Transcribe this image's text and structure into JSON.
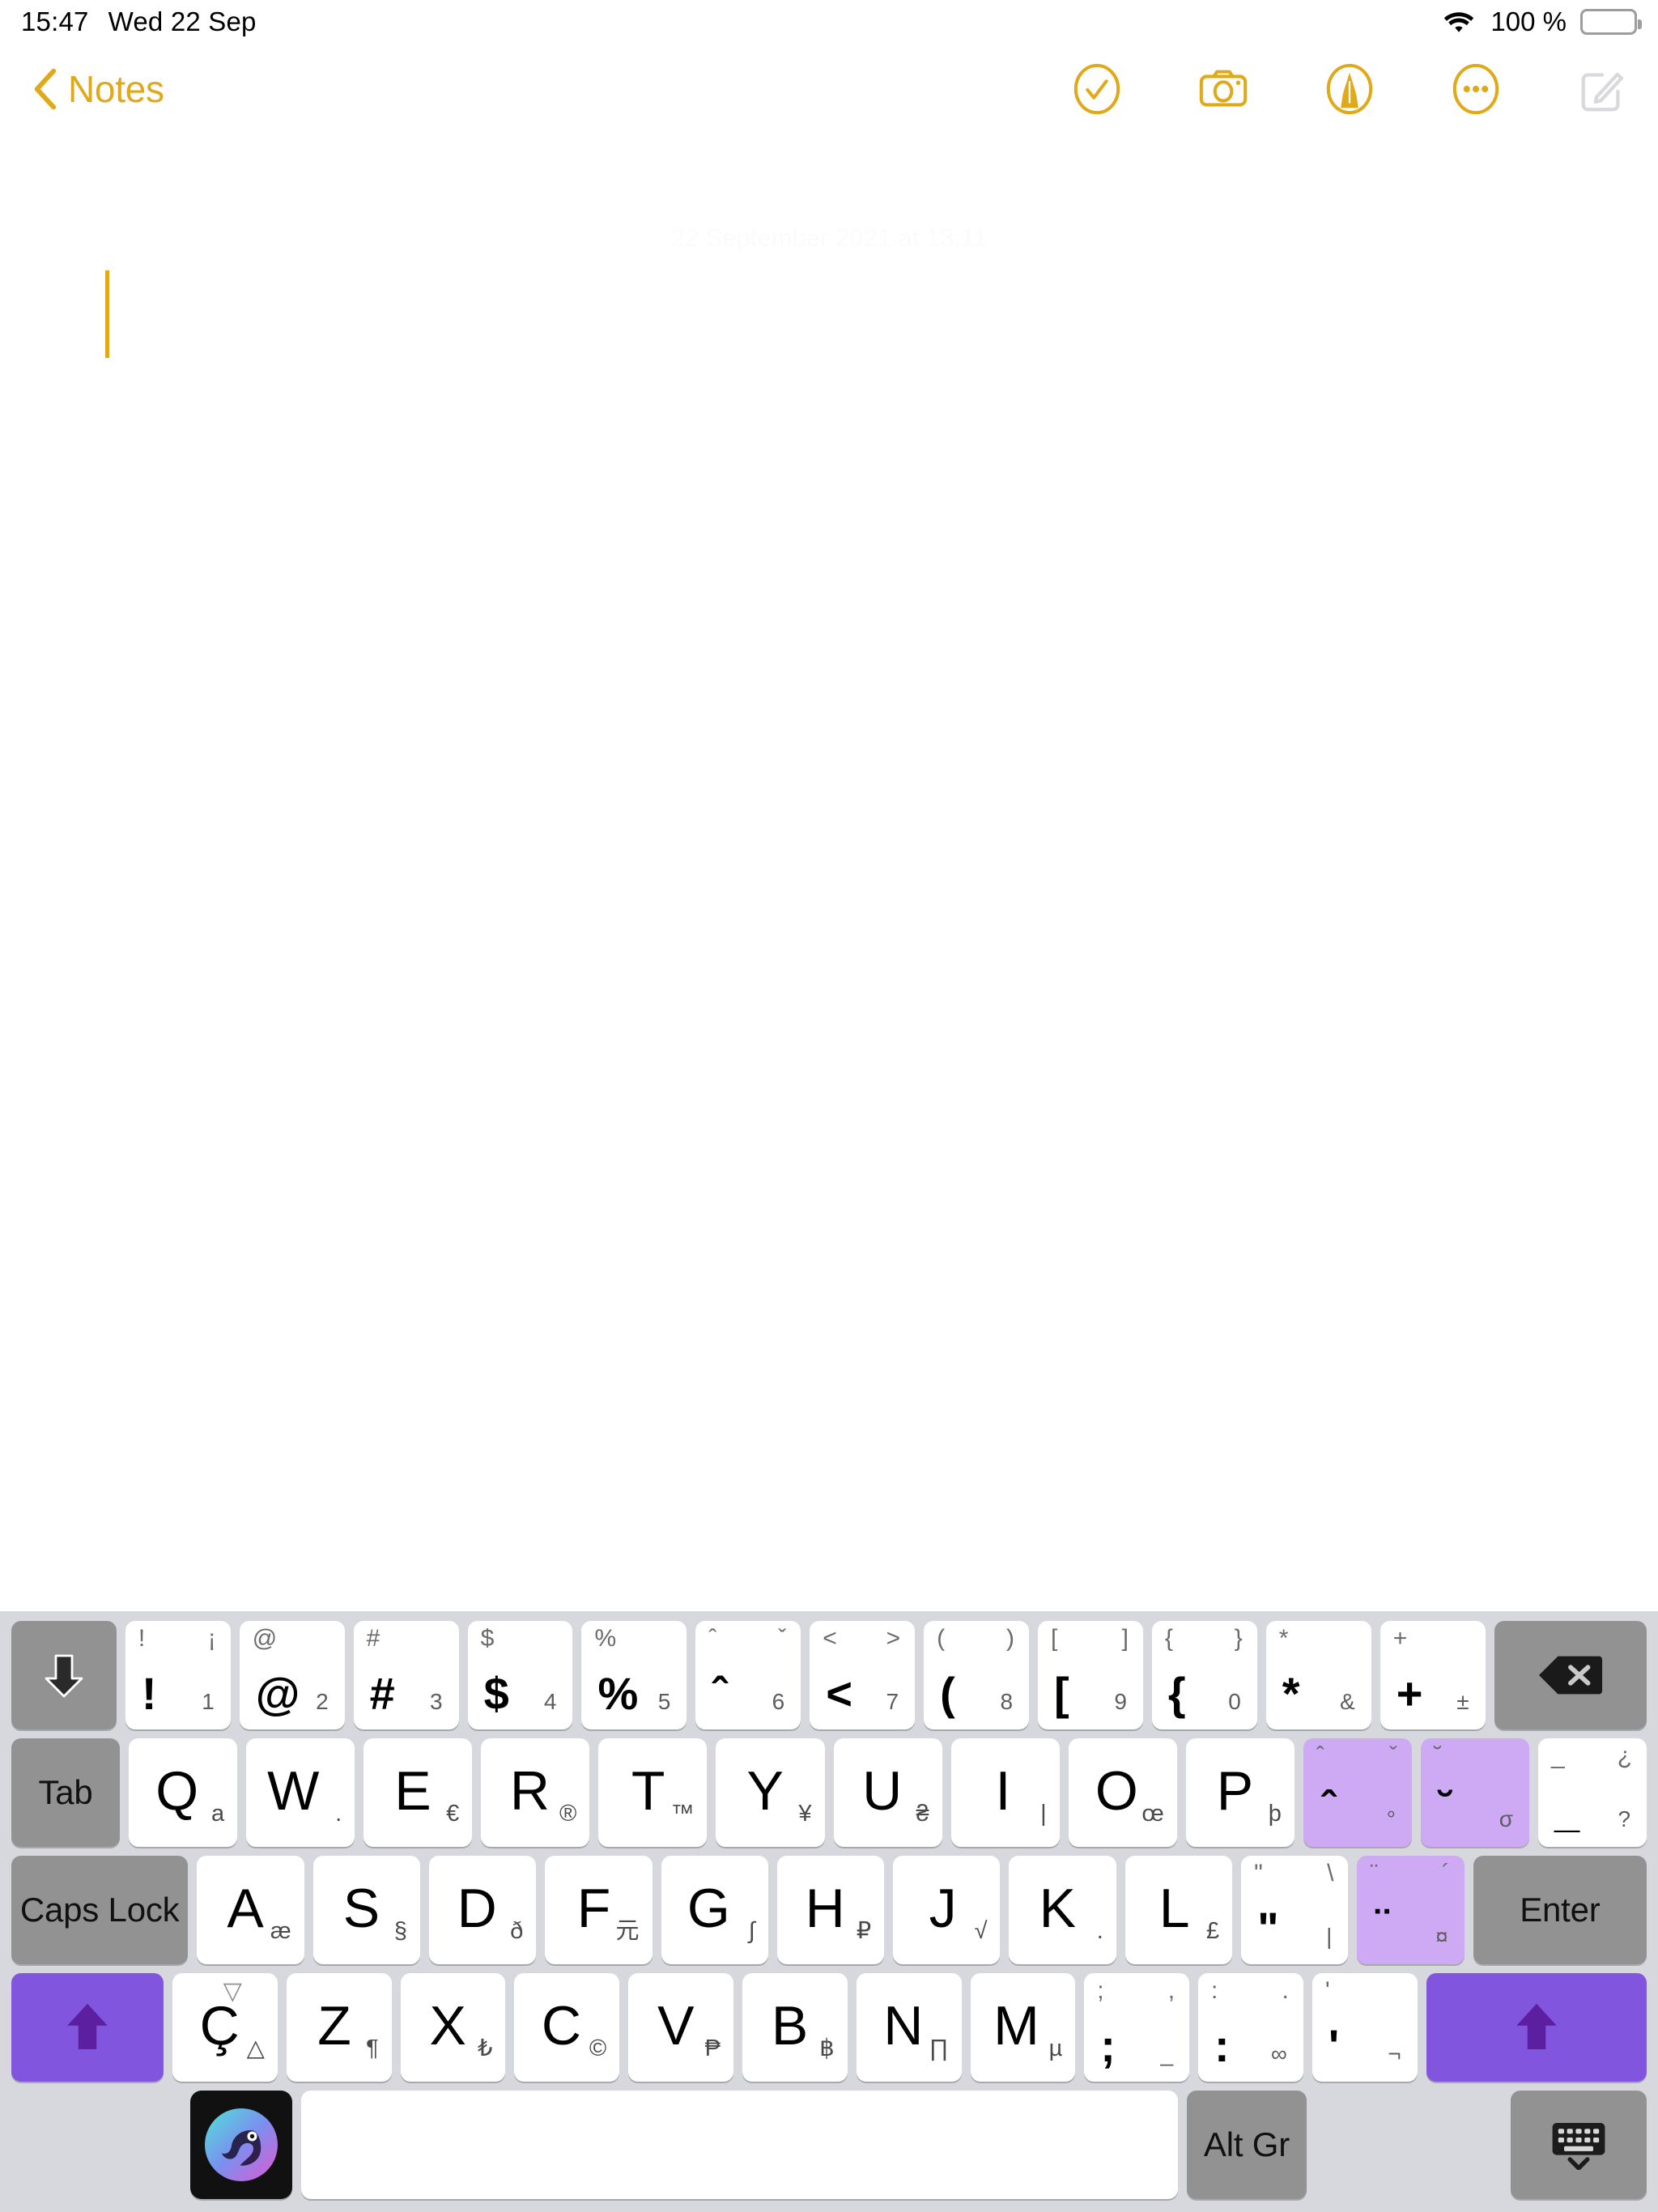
{
  "statusbar": {
    "time": "15:47",
    "date": "Wed 22 Sep",
    "wifi_icon": "wifi-icon",
    "battery_percent": "100 %",
    "battery_icon": "battery-full-icon"
  },
  "navbar": {
    "back_label": "Notes",
    "back_icon": "chevron-left-icon",
    "accent_color": "#E0A919",
    "tools": [
      {
        "name": "checklist-circle-icon",
        "label": "Checklist"
      },
      {
        "name": "camera-icon",
        "label": "Camera"
      },
      {
        "name": "markup-pen-circle-icon",
        "label": "Markup"
      },
      {
        "name": "more-circle-icon",
        "label": "More"
      },
      {
        "name": "compose-icon",
        "label": "New Note"
      }
    ]
  },
  "note": {
    "date_stamp": "22 September 2021 at 13:11",
    "body_text": "",
    "caret_color": "#E0A919"
  },
  "keyboard": {
    "background_color": "#d7d8dd",
    "key_color": "#ffffff",
    "fn_key_color": "#929292",
    "shift_key_color": "#8255df",
    "dead_key_color": "#ceaaf5",
    "row_number": [
      {
        "name": "collapse-key",
        "icon": "arrow-down-icon",
        "type": "fn"
      },
      {
        "tl": "!",
        "tr": "¡",
        "main": "!",
        "sub": "1"
      },
      {
        "tl": "@",
        "tr": "",
        "main": "@",
        "sub": "2"
      },
      {
        "tl": "#",
        "tr": "",
        "main": "#",
        "sub": "3"
      },
      {
        "tl": "$",
        "tr": "",
        "main": "$",
        "sub": "4"
      },
      {
        "tl": "%",
        "tr": "",
        "main": "%",
        "sub": "5"
      },
      {
        "tl": "ˆ",
        "tr": "ˇ",
        "main": "ˆ",
        "sub": "6"
      },
      {
        "tl": "<",
        "tr": ">",
        "main": "<",
        "sub": "7"
      },
      {
        "tl": "(",
        "tr": ")",
        "main": "(",
        "sub": "8"
      },
      {
        "tl": "[",
        "tr": "]",
        "main": "[",
        "sub": "9"
      },
      {
        "tl": "{",
        "tr": "}",
        "main": "{",
        "sub": "0"
      },
      {
        "tl": "*",
        "tr": "",
        "main": "*",
        "sub": "&"
      },
      {
        "tl": "+",
        "tr": "",
        "main": "+",
        "sub": "±"
      },
      {
        "name": "backspace-key",
        "icon": "backspace-icon",
        "type": "fn"
      }
    ],
    "row_top": [
      {
        "name": "tab-key",
        "label": "Tab",
        "type": "fn"
      },
      {
        "letter": "Q",
        "sub": "a"
      },
      {
        "letter": "W",
        "sub": "."
      },
      {
        "letter": "E",
        "sub": "€"
      },
      {
        "letter": "R",
        "sub": "®"
      },
      {
        "letter": "T",
        "sub": "™"
      },
      {
        "letter": "Y",
        "sub": "¥"
      },
      {
        "letter": "U",
        "sub": "₴"
      },
      {
        "letter": "I",
        "sub": "|"
      },
      {
        "letter": "O",
        "sub": "œ"
      },
      {
        "letter": "P",
        "sub": "þ"
      },
      {
        "type": "dead",
        "tl": "ˆ",
        "tr": "ˇ",
        "main": "ˆ",
        "sub": "°"
      },
      {
        "type": "dead",
        "tl": "˘",
        "tr": "",
        "main": "˘",
        "sub": "σ"
      },
      {
        "tl": "_",
        "tr": "¿",
        "main": "_",
        "sub": "?"
      }
    ],
    "row_home": [
      {
        "name": "caps-lock-key",
        "label": "Caps Lock",
        "type": "fn"
      },
      {
        "letter": "A",
        "sub": "æ"
      },
      {
        "letter": "S",
        "sub": "§"
      },
      {
        "letter": "D",
        "sub": "ð"
      },
      {
        "letter": "F",
        "sub": "元"
      },
      {
        "letter": "G",
        "sub": "∫"
      },
      {
        "letter": "H",
        "sub": "₽"
      },
      {
        "letter": "J",
        "sub": "√"
      },
      {
        "letter": "K",
        "sub": "."
      },
      {
        "letter": "L",
        "sub": "£"
      },
      {
        "tl": "\"",
        "tr": "\\",
        "main": "\"",
        "sub": "|"
      },
      {
        "type": "dead",
        "tl": "¨",
        "tr": "´",
        "main": "¨",
        "sub": "¤"
      },
      {
        "name": "enter-key",
        "label": "Enter",
        "type": "fn"
      }
    ],
    "row_bottom_letters": [
      {
        "name": "shift-left-key",
        "icon": "shift-up-arrow-icon",
        "type": "shift"
      },
      {
        "letter": "Ç",
        "top": "▽",
        "sub": "△"
      },
      {
        "letter": "Z",
        "sub": "¶"
      },
      {
        "letter": "X",
        "sub": "₺"
      },
      {
        "letter": "C",
        "sub": "©"
      },
      {
        "letter": "V",
        "sub": "₱"
      },
      {
        "letter": "B",
        "sub": "฿"
      },
      {
        "letter": "N",
        "sub": "∏"
      },
      {
        "letter": "M",
        "sub": "µ"
      },
      {
        "tl": ";",
        "tr": ",",
        "main": ";",
        "sub": "_"
      },
      {
        "tl": ":",
        "tr": ".",
        "main": ":",
        "sub": "∞"
      },
      {
        "tl": "'",
        "tr": "",
        "main": "'",
        "sub": "¬"
      },
      {
        "name": "shift-right-key",
        "icon": "shift-up-arrow-icon",
        "type": "shift"
      }
    ],
    "row_space": {
      "gboard_icon": "chameleon-gboard-icon",
      "space_label": "",
      "altgr_label": "Alt Gr",
      "dismiss_icon": "keyboard-dismiss-icon"
    }
  }
}
